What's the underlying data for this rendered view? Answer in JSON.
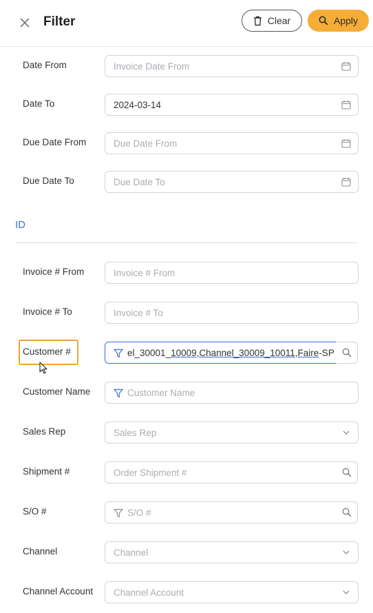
{
  "header": {
    "close_icon": "close-icon",
    "title": "Filter",
    "clear_label": "Clear",
    "apply_label": "Apply",
    "accent_color": "#f6ad37"
  },
  "dates": {
    "date_from_label": "Date From",
    "date_from_placeholder": "Invoice Date From",
    "date_to_label": "Date To",
    "date_to_value": "2024-03-14",
    "due_from_label": "Due Date From",
    "due_from_placeholder": "Due Date From",
    "due_to_label": "Due Date To",
    "due_to_placeholder": "Due Date To"
  },
  "id_section": {
    "title": "ID",
    "title_color": "#3f6ae0",
    "invoice_from_label": "Invoice # From",
    "invoice_from_placeholder": "Invoice # From",
    "invoice_to_label": "Invoice # To",
    "invoice_to_placeholder": "Invoice # To",
    "customer_label": "Customer #",
    "customer_value_parts": [
      "el_30001_",
      "10009",
      ",Channel_30009_",
      "10011",
      ",",
      "Faire",
      "-SP"
    ],
    "customer_name_label": "Customer Name",
    "customer_name_placeholder": "Customer Name",
    "sales_rep_label": "Sales Rep",
    "sales_rep_placeholder": "Sales Rep",
    "shipment_label": "Shipment #",
    "shipment_placeholder": "Order Shipment #",
    "so_label": "S/O #",
    "so_placeholder": "S/O #",
    "channel_label": "Channel",
    "channel_placeholder": "Channel",
    "channel_account_label": "Channel Account",
    "channel_account_placeholder": "Channel Account"
  }
}
